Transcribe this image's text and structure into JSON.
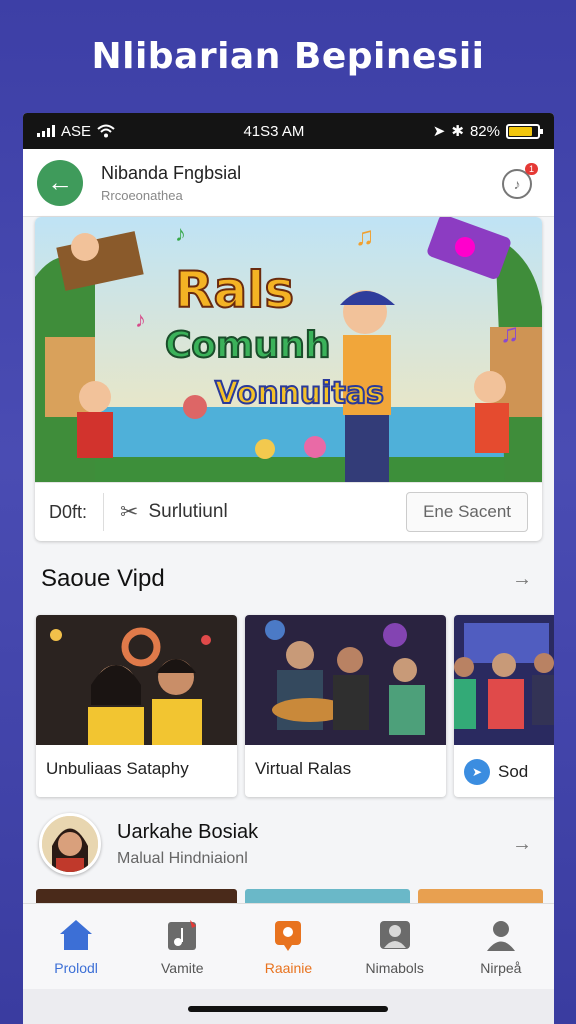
{
  "headline": "Nlibarian Bepinesii",
  "status_bar": {
    "carrier": "ASE",
    "time": "41S3 AM",
    "battery": "82%",
    "battery_level": 0.82
  },
  "app_bar": {
    "title": "Nibanda Fngbsial",
    "subtitle": "Rrcoeonathea",
    "badge": "1"
  },
  "hero": {
    "banner_line1": "Rals",
    "banner_line2": "Comunh",
    "banner_line3": "Vonnuitas",
    "label": "D0ft:",
    "action_text": "Surlutiunl",
    "button": "Ene Sacent"
  },
  "section": {
    "title": "Saoue Vipd"
  },
  "tiles": [
    {
      "caption": "Unbuliaas Sataphy"
    },
    {
      "caption": "Virtual Ralas"
    },
    {
      "caption": "Sod"
    }
  ],
  "profile": {
    "name": "Uarkahe Bosiak",
    "subtitle": "Malual Hindniaionl"
  },
  "nav": [
    {
      "label": "Prolodl",
      "icon": "home-icon",
      "color": "#3c6fd6"
    },
    {
      "label": "Vamite",
      "icon": "music-card-icon",
      "color": "#555555"
    },
    {
      "label": "Raainie",
      "icon": "chat-bubble-icon",
      "color": "#e8731f"
    },
    {
      "label": "Nimabols",
      "icon": "group-icon",
      "color": "#555555"
    },
    {
      "label": "Nirpeå",
      "icon": "person-icon",
      "color": "#555555"
    }
  ]
}
